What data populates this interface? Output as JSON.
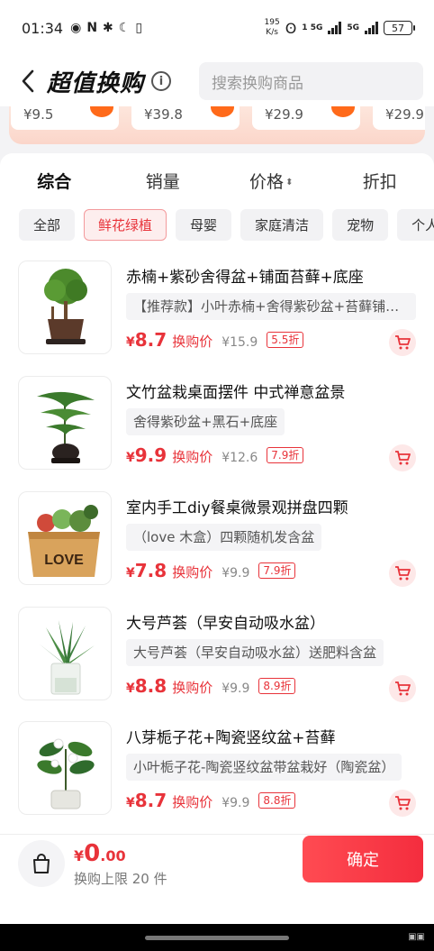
{
  "status": {
    "time": "01:34",
    "left_icons": [
      "eye-icon",
      "n-icon",
      "bluetooth-icon",
      "moon-icon",
      "vibrate-icon"
    ],
    "net_speed": "195",
    "net_unit": "K/s",
    "sim1": "1 5G",
    "sim2": "5G",
    "battery": "57"
  },
  "header": {
    "back_icon": "chevron-left-icon",
    "title": "超值换购",
    "info": "i",
    "search_placeholder": "搜索换购商品"
  },
  "strip": {
    "prices": [
      "¥9.5",
      "¥39.8",
      "¥29.9",
      "¥29.9"
    ]
  },
  "sort": {
    "tabs": [
      "综合",
      "销量",
      "价格",
      "折扣"
    ],
    "active": "综合"
  },
  "categories": [
    "全部",
    "鲜花绿植",
    "母婴",
    "家庭清洁",
    "宠物",
    "个人"
  ],
  "products": [
    {
      "name": "赤楠+紫砂舍得盆+铺面苔藓+底座",
      "desc": "【推荐款】小叶赤楠+舍得紫砂盆+苔藓铺面…",
      "price_int": "8.7",
      "price_label": "换购价",
      "orig": "¥15.9",
      "discount": "5.5折"
    },
    {
      "name": "文竹盆栽桌面摆件 中式禅意盆景",
      "desc": "舍得紫砂盆+黑石+底座",
      "price_int": "9.9",
      "price_label": "换购价",
      "orig": "¥12.6",
      "discount": "7.9折"
    },
    {
      "name": "室内手工diy餐桌微景观拼盘四颗",
      "desc": "（love 木盒）四颗随机发含盆",
      "price_int": "7.8",
      "price_label": "换购价",
      "orig": "¥9.9",
      "discount": "7.9折"
    },
    {
      "name": "大号芦荟（早安自动吸水盆）",
      "desc": "大号芦荟（早安自动吸水盆）送肥料含盆",
      "price_int": "8.8",
      "price_label": "换购价",
      "orig": "¥9.9",
      "discount": "8.9折"
    },
    {
      "name": "八芽栀子花+陶瓷竖纹盆+苔藓",
      "desc": "小叶栀子花-陶瓷竖纹盆带盆栽好（陶瓷盆）",
      "price_int": "8.7",
      "price_label": "换购价",
      "orig": "¥9.9",
      "discount": "8.8折"
    }
  ],
  "currency": "¥",
  "bottom": {
    "total_int": "0",
    "total_dec": ".00",
    "limit": "换购上限 20 件",
    "confirm": "确定"
  },
  "thumb_love": "LOVE"
}
